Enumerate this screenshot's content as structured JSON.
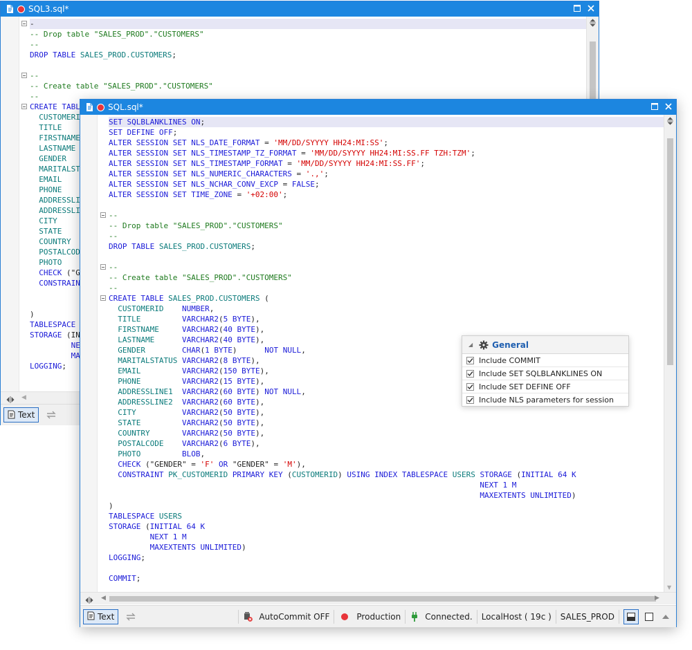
{
  "back_window": {
    "title": "SQL3.sql*",
    "text_button": "Text",
    "lines": [
      [
        [
          "pn",
          "-"
        ]
      ],
      [
        [
          "cm",
          "-- Drop table \"SALES_PROD\".\"CUSTOMERS\""
        ]
      ],
      [
        [
          "cm",
          "--"
        ]
      ],
      [
        [
          "kw",
          "DROP TABLE "
        ],
        [
          "id",
          "SALES_PROD.CUSTOMERS"
        ],
        [
          "pn",
          ";"
        ]
      ],
      [],
      [
        [
          "cm",
          "--"
        ]
      ],
      [
        [
          "cm",
          "-- Create table \"SALES_PROD\".\"CUSTOMERS\""
        ]
      ],
      [
        [
          "cm",
          "--"
        ]
      ],
      [
        [
          "kw",
          "CREATE TABLE"
        ]
      ],
      [
        [
          "id",
          "  CUSTOMERID"
        ]
      ],
      [
        [
          "id",
          "  TITLE"
        ]
      ],
      [
        [
          "id",
          "  FIRSTNAME"
        ]
      ],
      [
        [
          "id",
          "  LASTNAME"
        ]
      ],
      [
        [
          "id",
          "  GENDER"
        ]
      ],
      [
        [
          "id",
          "  MARITALSTATUS"
        ]
      ],
      [
        [
          "id",
          "  EMAIL"
        ]
      ],
      [
        [
          "id",
          "  PHONE"
        ]
      ],
      [
        [
          "id",
          "  ADDRESSLINE1"
        ]
      ],
      [
        [
          "id",
          "  ADDRESSLINE2"
        ]
      ],
      [
        [
          "id",
          "  CITY"
        ]
      ],
      [
        [
          "id",
          "  STATE"
        ]
      ],
      [
        [
          "id",
          "  COUNTRY"
        ]
      ],
      [
        [
          "id",
          "  POSTALCODE"
        ]
      ],
      [
        [
          "id",
          "  PHOTO"
        ]
      ],
      [
        [
          "kw",
          "  CHECK "
        ],
        [
          "pn",
          "(\"GENDER\""
        ]
      ],
      [
        [
          "kw",
          "  CONSTRAINT"
        ]
      ],
      [],
      [],
      [
        [
          "pn",
          ")"
        ]
      ],
      [
        [
          "kw",
          "TABLESPACE"
        ]
      ],
      [
        [
          "kw",
          "STORAGE "
        ],
        [
          "pn",
          "(INITIAL"
        ]
      ],
      [
        [
          "kw",
          "         NEXT"
        ]
      ],
      [
        [
          "kw",
          "         MAXEXTENTS"
        ]
      ],
      [
        [
          "kw",
          "LOGGING"
        ],
        [
          "pn",
          ";"
        ]
      ]
    ]
  },
  "front_window": {
    "title": "SQL.sql*",
    "lines": [
      [
        [
          "kw",
          "SET SQLBLANKLINES ON"
        ],
        [
          "pn",
          ";"
        ]
      ],
      [
        [
          "kw",
          "SET DEFINE OFF"
        ],
        [
          "pn",
          ";"
        ]
      ],
      [
        [
          "kw",
          "ALTER SESSION SET NLS_DATE_FORMAT "
        ],
        [
          "pn",
          "= "
        ],
        [
          "str",
          "'MM/DD/SYYYY HH24:MI:SS'"
        ],
        [
          "pn",
          ";"
        ]
      ],
      [
        [
          "kw",
          "ALTER SESSION SET NLS_TIMESTAMP_TZ_FORMAT "
        ],
        [
          "pn",
          "= "
        ],
        [
          "str",
          "'MM/DD/SYYYY HH24:MI:SS.FF TZH:TZM'"
        ],
        [
          "pn",
          ";"
        ]
      ],
      [
        [
          "kw",
          "ALTER SESSION SET NLS_TIMESTAMP_FORMAT "
        ],
        [
          "pn",
          "= "
        ],
        [
          "str",
          "'MM/DD/SYYYY HH24:MI:SS.FF'"
        ],
        [
          "pn",
          ";"
        ]
      ],
      [
        [
          "kw",
          "ALTER SESSION SET NLS_NUMERIC_CHARACTERS "
        ],
        [
          "pn",
          "= "
        ],
        [
          "str",
          "'.,'"
        ],
        [
          "pn",
          ";"
        ]
      ],
      [
        [
          "kw",
          "ALTER SESSION SET NLS_NCHAR_CONV_EXCP "
        ],
        [
          "pn",
          "= "
        ],
        [
          "kw",
          "FALSE"
        ],
        [
          "pn",
          ";"
        ]
      ],
      [
        [
          "kw",
          "ALTER SESSION SET TIME_ZONE "
        ],
        [
          "pn",
          "= "
        ],
        [
          "str",
          "'+02:00'"
        ],
        [
          "pn",
          ";"
        ]
      ],
      [],
      [
        [
          "cm",
          "--"
        ]
      ],
      [
        [
          "cm",
          "-- Drop table \"SALES_PROD\".\"CUSTOMERS\""
        ]
      ],
      [
        [
          "cm",
          "--"
        ]
      ],
      [
        [
          "kw",
          "DROP TABLE "
        ],
        [
          "id",
          "SALES_PROD.CUSTOMERS"
        ],
        [
          "pn",
          ";"
        ]
      ],
      [],
      [
        [
          "cm",
          "--"
        ]
      ],
      [
        [
          "cm",
          "-- Create table \"SALES_PROD\".\"CUSTOMERS\""
        ]
      ],
      [
        [
          "cm",
          "--"
        ]
      ],
      [
        [
          "kw",
          "CREATE TABLE "
        ],
        [
          "id",
          "SALES_PROD.CUSTOMERS "
        ],
        [
          "pn",
          "("
        ]
      ],
      [
        [
          "id",
          "  CUSTOMERID    "
        ],
        [
          "kw",
          "NUMBER"
        ],
        [
          "pn",
          ","
        ]
      ],
      [
        [
          "id",
          "  TITLE         "
        ],
        [
          "kw",
          "VARCHAR2"
        ],
        [
          "pn",
          "("
        ],
        [
          "num",
          "5 "
        ],
        [
          "kw",
          "BYTE"
        ],
        [
          "pn",
          "),"
        ]
      ],
      [
        [
          "id",
          "  FIRSTNAME     "
        ],
        [
          "kw",
          "VARCHAR2"
        ],
        [
          "pn",
          "("
        ],
        [
          "num",
          "40 "
        ],
        [
          "kw",
          "BYTE"
        ],
        [
          "pn",
          "),"
        ]
      ],
      [
        [
          "id",
          "  LASTNAME      "
        ],
        [
          "kw",
          "VARCHAR2"
        ],
        [
          "pn",
          "("
        ],
        [
          "num",
          "40 "
        ],
        [
          "kw",
          "BYTE"
        ],
        [
          "pn",
          "),"
        ]
      ],
      [
        [
          "id",
          "  GENDER        "
        ],
        [
          "kw",
          "CHAR"
        ],
        [
          "pn",
          "("
        ],
        [
          "num",
          "1 "
        ],
        [
          "kw",
          "BYTE"
        ],
        [
          "pn",
          ")      "
        ],
        [
          "kw",
          "NOT NULL"
        ],
        [
          "pn",
          ","
        ]
      ],
      [
        [
          "id",
          "  MARITALSTATUS "
        ],
        [
          "kw",
          "VARCHAR2"
        ],
        [
          "pn",
          "("
        ],
        [
          "num",
          "8 "
        ],
        [
          "kw",
          "BYTE"
        ],
        [
          "pn",
          "),"
        ]
      ],
      [
        [
          "id",
          "  EMAIL         "
        ],
        [
          "kw",
          "VARCHAR2"
        ],
        [
          "pn",
          "("
        ],
        [
          "num",
          "150 "
        ],
        [
          "kw",
          "BYTE"
        ],
        [
          "pn",
          "),"
        ]
      ],
      [
        [
          "id",
          "  PHONE         "
        ],
        [
          "kw",
          "VARCHAR2"
        ],
        [
          "pn",
          "("
        ],
        [
          "num",
          "15 "
        ],
        [
          "kw",
          "BYTE"
        ],
        [
          "pn",
          "),"
        ]
      ],
      [
        [
          "id",
          "  ADDRESSLINE1  "
        ],
        [
          "kw",
          "VARCHAR2"
        ],
        [
          "pn",
          "("
        ],
        [
          "num",
          "60 "
        ],
        [
          "kw",
          "BYTE"
        ],
        [
          "pn",
          ") "
        ],
        [
          "kw",
          "NOT NULL"
        ],
        [
          "pn",
          ","
        ]
      ],
      [
        [
          "id",
          "  ADDRESSLINE2  "
        ],
        [
          "kw",
          "VARCHAR2"
        ],
        [
          "pn",
          "("
        ],
        [
          "num",
          "60 "
        ],
        [
          "kw",
          "BYTE"
        ],
        [
          "pn",
          "),"
        ]
      ],
      [
        [
          "id",
          "  CITY          "
        ],
        [
          "kw",
          "VARCHAR2"
        ],
        [
          "pn",
          "("
        ],
        [
          "num",
          "50 "
        ],
        [
          "kw",
          "BYTE"
        ],
        [
          "pn",
          "),"
        ]
      ],
      [
        [
          "id",
          "  STATE         "
        ],
        [
          "kw",
          "VARCHAR2"
        ],
        [
          "pn",
          "("
        ],
        [
          "num",
          "50 "
        ],
        [
          "kw",
          "BYTE"
        ],
        [
          "pn",
          "),"
        ]
      ],
      [
        [
          "id",
          "  COUNTRY       "
        ],
        [
          "kw",
          "VARCHAR2"
        ],
        [
          "pn",
          "("
        ],
        [
          "num",
          "50 "
        ],
        [
          "kw",
          "BYTE"
        ],
        [
          "pn",
          "),"
        ]
      ],
      [
        [
          "id",
          "  POSTALCODE    "
        ],
        [
          "kw",
          "VARCHAR2"
        ],
        [
          "pn",
          "("
        ],
        [
          "num",
          "6 "
        ],
        [
          "kw",
          "BYTE"
        ],
        [
          "pn",
          "),"
        ]
      ],
      [
        [
          "id",
          "  PHOTO         "
        ],
        [
          "kw",
          "BLOB"
        ],
        [
          "pn",
          ","
        ]
      ],
      [
        [
          "kw",
          "  CHECK "
        ],
        [
          "pn",
          "(\"GENDER\" = "
        ],
        [
          "str",
          "'F'"
        ],
        [
          "kw",
          " OR "
        ],
        [
          "pn",
          "\"GENDER\" = "
        ],
        [
          "str",
          "'M'"
        ],
        [
          "pn",
          "),"
        ]
      ],
      [
        [
          "kw",
          "  CONSTRAINT "
        ],
        [
          "id",
          "PK_CUSTOMERID "
        ],
        [
          "kw",
          "PRIMARY KEY "
        ],
        [
          "pn",
          "("
        ],
        [
          "id",
          "CUSTOMERID"
        ],
        [
          "pn",
          ") "
        ],
        [
          "kw",
          "USING INDEX TABLESPACE "
        ],
        [
          "id",
          "USERS "
        ],
        [
          "kw",
          "STORAGE "
        ],
        [
          "pn",
          "("
        ],
        [
          "kw",
          "INITIAL "
        ],
        [
          "num",
          "64 "
        ],
        [
          "kw",
          "K"
        ]
      ],
      [
        [
          "kw",
          "                                                                                 NEXT "
        ],
        [
          "num",
          "1 "
        ],
        [
          "kw",
          "M"
        ]
      ],
      [
        [
          "kw",
          "                                                                                 MAXEXTENTS UNLIMITED"
        ],
        [
          "pn",
          ")"
        ]
      ],
      [
        [
          "pn",
          ")"
        ]
      ],
      [
        [
          "kw",
          "TABLESPACE "
        ],
        [
          "id",
          "USERS"
        ]
      ],
      [
        [
          "kw",
          "STORAGE "
        ],
        [
          "pn",
          "("
        ],
        [
          "kw",
          "INITIAL "
        ],
        [
          "num",
          "64 "
        ],
        [
          "kw",
          "K"
        ]
      ],
      [
        [
          "kw",
          "         NEXT "
        ],
        [
          "num",
          "1 "
        ],
        [
          "kw",
          "M"
        ]
      ],
      [
        [
          "kw",
          "         MAXEXTENTS UNLIMITED"
        ],
        [
          "pn",
          ")"
        ]
      ],
      [
        [
          "kw",
          "LOGGING"
        ],
        [
          "pn",
          ";"
        ]
      ],
      [],
      [
        [
          "kw",
          "COMMIT"
        ],
        [
          "pn",
          ";"
        ]
      ]
    ]
  },
  "status": {
    "text_button": "Text",
    "autocommit": "AutoCommit OFF",
    "environment": "Production",
    "connection": "Connected.",
    "server": "LocalHost ( 19c )",
    "schema": "SALES_PROD"
  },
  "options_panel": {
    "title": "General",
    "items": [
      {
        "label": "Include COMMIT",
        "checked": true
      },
      {
        "label": "Include SET SQLBLANKLINES ON",
        "checked": true
      },
      {
        "label": "Include SET DEFINE OFF",
        "checked": true
      },
      {
        "label": "Include NLS parameters for session",
        "checked": true
      }
    ]
  },
  "colors": {
    "titlebar": "#1c86e0",
    "keyword": "#1a1ad8",
    "string": "#d40000",
    "comment": "#1e7a1e",
    "identifier": "#0a7a7a",
    "environment_dot": "#e8353a",
    "connected_plug": "#2e9b3a"
  }
}
